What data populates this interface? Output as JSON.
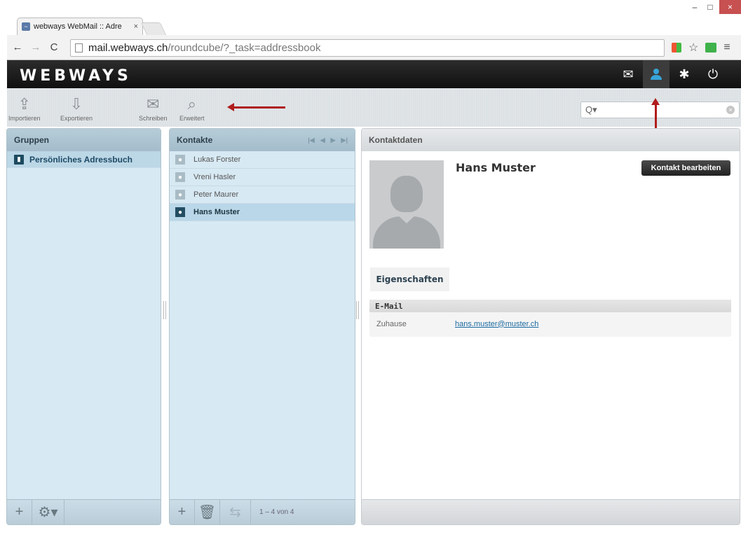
{
  "browser": {
    "tab_title": "webways WebMail :: Adre",
    "tab_close": "×",
    "address_host": "mail.webways.ch",
    "address_path": "/roundcube/?_task=addressbook"
  },
  "header": {
    "logo": "WEBWAYS"
  },
  "toolbar": {
    "import_label": "Importieren",
    "export_label": "Exportieren",
    "compose_label": "Schreiben",
    "advanced_label": "Erweitert",
    "search_placeholder": ""
  },
  "groups": {
    "title": "Gruppen",
    "items": [
      {
        "label": "Persönliches Adressbuch"
      }
    ]
  },
  "contacts": {
    "title": "Kontakte",
    "items": [
      {
        "label": "Lukas Forster"
      },
      {
        "label": "Vreni Hasler"
      },
      {
        "label": "Peter Maurer"
      },
      {
        "label": "Hans Muster"
      }
    ],
    "count": "1 – 4 von 4"
  },
  "details": {
    "title": "Kontaktdaten",
    "name": "Hans Muster",
    "edit_label": "Kontakt bearbeiten",
    "tab_label": "Eigenschaften",
    "section_title": "E-Mail",
    "field_label": "Zuhause",
    "field_value": "hans.muster@muster.ch"
  },
  "colors": {
    "accent": "#37a5d8",
    "annotation_arrow": "#b01c1c",
    "panel_bg": "#d7e9f3"
  }
}
